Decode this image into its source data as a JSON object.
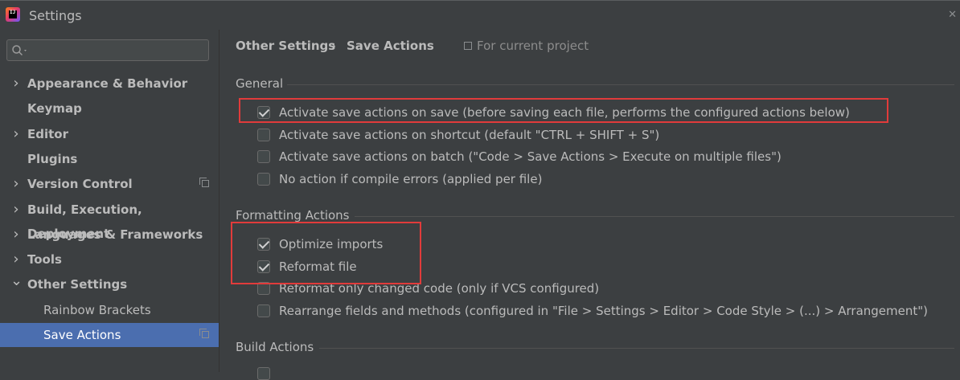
{
  "window": {
    "title": "Settings",
    "logo_text": "IJ"
  },
  "sidebar": {
    "search": {
      "placeholder": ""
    },
    "items": [
      {
        "label": "Appearance & Behavior",
        "expandable": true,
        "expanded": false,
        "level": 0
      },
      {
        "label": "Keymap",
        "expandable": false,
        "level": 0
      },
      {
        "label": "Editor",
        "expandable": true,
        "expanded": false,
        "level": 0
      },
      {
        "label": "Plugins",
        "expandable": false,
        "level": 0
      },
      {
        "label": "Version Control",
        "expandable": true,
        "expanded": false,
        "level": 0,
        "project_scope": true
      },
      {
        "label": "Build, Execution, Deployment",
        "expandable": true,
        "expanded": false,
        "level": 0
      },
      {
        "label": "Languages & Frameworks",
        "expandable": true,
        "expanded": false,
        "level": 0
      },
      {
        "label": "Tools",
        "expandable": true,
        "expanded": false,
        "level": 0
      },
      {
        "label": "Other Settings",
        "expandable": true,
        "expanded": true,
        "level": 0
      },
      {
        "label": "Rainbow Brackets",
        "expandable": false,
        "level": 1
      },
      {
        "label": "Save Actions",
        "expandable": false,
        "level": 1,
        "selected": true,
        "project_scope": true
      }
    ]
  },
  "breadcrumb": {
    "parent": "Other Settings",
    "separator": "›",
    "current": "Save Actions"
  },
  "scope": {
    "label": "For current project"
  },
  "sections": {
    "general": {
      "title": "General",
      "options": [
        {
          "label": "Activate save actions on save (before saving each file, performs the configured actions below)",
          "checked": true
        },
        {
          "label": "Activate save actions on shortcut (default \"CTRL + SHIFT + S\")",
          "checked": false
        },
        {
          "label": "Activate save actions on batch (\"Code > Save Actions > Execute on multiple files\")",
          "checked": false
        },
        {
          "label": "No action if compile errors (applied per file)",
          "checked": false
        }
      ]
    },
    "formatting": {
      "title": "Formatting Actions",
      "options": [
        {
          "label": "Optimize imports",
          "checked": true
        },
        {
          "label": "Reformat file",
          "checked": true
        },
        {
          "label": "Reformat only changed code (only if VCS configured)",
          "checked": false
        },
        {
          "label": "Rearrange fields and methods (configured in \"File > Settings > Editor > Code Style > (...) > Arrangement\")",
          "checked": false
        }
      ]
    },
    "build": {
      "title": "Build Actions"
    }
  },
  "colors": {
    "background": "#3c3f41",
    "selection": "#4b6eaf",
    "highlight_box": "#e13b3b",
    "text": "#bbbbbb"
  }
}
